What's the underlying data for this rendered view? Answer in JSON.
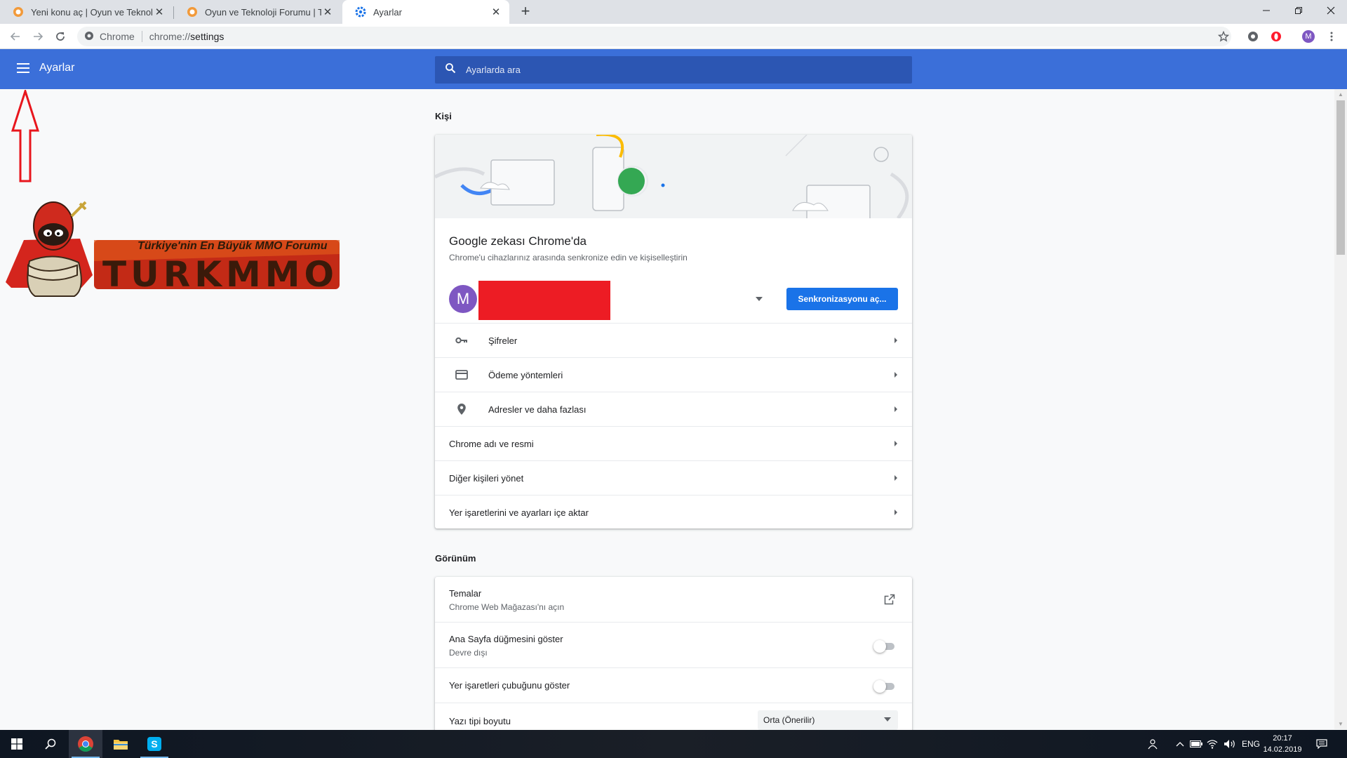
{
  "browser": {
    "tabs": [
      {
        "title": "Yeni konu aç | Oyun ve Teknoloji",
        "active": false
      },
      {
        "title": "Oyun ve Teknoloji Forumu | Turk",
        "active": false
      },
      {
        "title": "Ayarlar",
        "active": true
      }
    ],
    "omnibox": {
      "chip": "Chrome",
      "url_prefix": "chrome://",
      "url_path": "settings"
    },
    "profile_letter": "M"
  },
  "settings": {
    "header_title": "Ayarlar",
    "search_placeholder": "Ayarlarda ara"
  },
  "logo": {
    "tagline": "Türkiye'nin En Büyük MMO Forumu",
    "word": "TURKMMO"
  },
  "person": {
    "section_title": "Kişi",
    "headline": "Google zekası Chrome'da",
    "subline": "Chrome'u cihazlarınız arasında senkronize edin ve kişiselleştirin",
    "avatar_letter": "M",
    "sync_button": "Senkronizasyonu aç...",
    "rows": [
      {
        "label": "Şifreler",
        "icon": "key-icon"
      },
      {
        "label": "Ödeme yöntemleri",
        "icon": "credit-card-icon"
      },
      {
        "label": "Adresler ve daha fazlası",
        "icon": "location-pin-icon"
      },
      {
        "label": "Chrome adı ve resmi"
      },
      {
        "label": "Diğer kişileri yönet"
      },
      {
        "label": "Yer işaretlerini ve ayarları içe aktar"
      }
    ]
  },
  "appearance": {
    "section_title": "Görünüm",
    "themes_title": "Temalar",
    "themes_sub": "Chrome Web Mağazası'nı açın",
    "home_title": "Ana Sayfa düğmesini göster",
    "home_sub": "Devre dışı",
    "home_enabled": false,
    "bookmarks_title": "Yer işaretleri çubuğunu göster",
    "bookmarks_enabled": false,
    "fontsize_title": "Yazı tipi boyutu",
    "fontsize_value": "Orta (Önerilir)"
  },
  "taskbar": {
    "language": "ENG",
    "time": "20:17",
    "date": "14.02.2019"
  },
  "colors": {
    "accent": "#3b6fd9",
    "button": "#1a73e8",
    "avatar": "#7e57c2",
    "redaction": "#ed1c24"
  }
}
